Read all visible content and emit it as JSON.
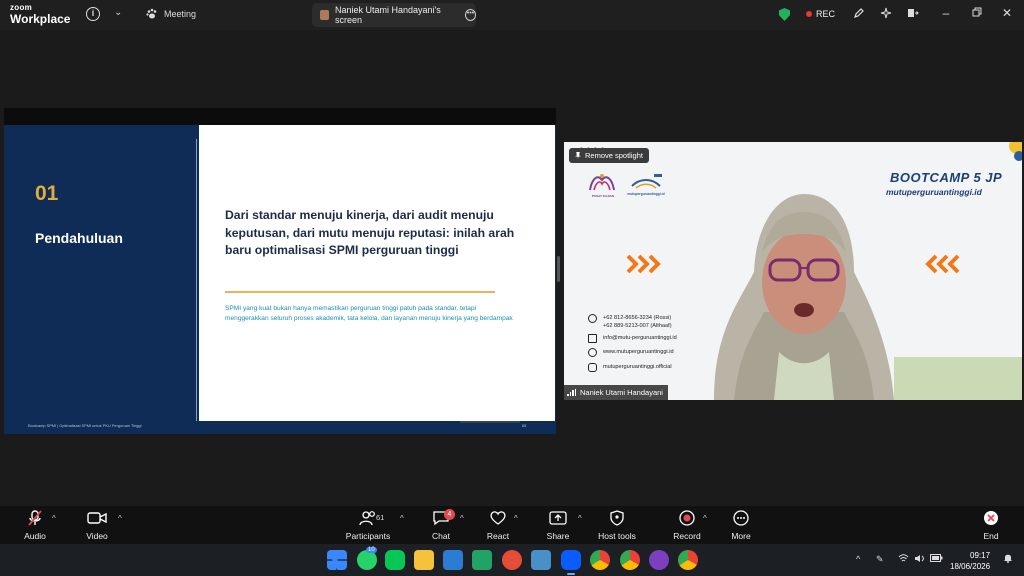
{
  "window": {
    "brand_top": "zoom",
    "brand_bottom": "Workplace",
    "meeting_label": "Meeting",
    "share_tab_label": "Naniek Utami Handayani's screen",
    "rec_label": "REC"
  },
  "slide": {
    "number": "01",
    "section_title": "Pendahuluan",
    "heading": "Dari standar menuju kinerja, dari audit menuju keputusan, dari mutu menuju reputasi: inilah arah baru optimalisasi SPMI perguruan tinggi",
    "body": "SPMI yang kuat bukan hanya memastikan perguruan tinggi patuh pada standar, tetapi menggerakkan seluruh proses akademik, tata kelola, dan layanan menuju kinerja yang berdampak",
    "footer": "Bootcamp SPMI | Optimalisasi SPMI untuk PKU Perguruan Tinggi",
    "page_number": "65"
  },
  "video": {
    "spotlight_label": "Remove spotlight",
    "logo1_text": "PUSAT KAJIAN",
    "logo2_text": "mutuperguruantinggi.id",
    "banner_title": "BOOTCAMP 5 JP",
    "banner_url": "mutuperguruantinggi.id",
    "contacts": {
      "phone1": "+62 812-8656-3234 (Rossi)",
      "phone2": "+62 889-5213-007 (Althaaf)",
      "email": "info@mutu-perguruantinggi.id",
      "web": "www.mutuperguruantinggi.id",
      "instagram": "mutuperguruantinggi.official"
    },
    "speaker_name": "Naniek Utami Handayani"
  },
  "toolbar": {
    "audio": "Audio",
    "video": "Video",
    "participants": "Participants",
    "participants_count": "61",
    "chat": "Chat",
    "chat_badge": "4",
    "react": "React",
    "share": "Share",
    "host_tools": "Host tools",
    "record": "Record",
    "more": "More",
    "end": "End"
  },
  "taskbar": {
    "whatsapp_badge": "10",
    "time": "09:17",
    "date": "18/06/2026"
  },
  "colors": {
    "slide_navy": "#0e2c55",
    "slide_gold": "#e3ad3a",
    "slide_teal": "#1a8fb0",
    "arrow_orange": "#f07a1a",
    "end_red": "#e5484d"
  }
}
